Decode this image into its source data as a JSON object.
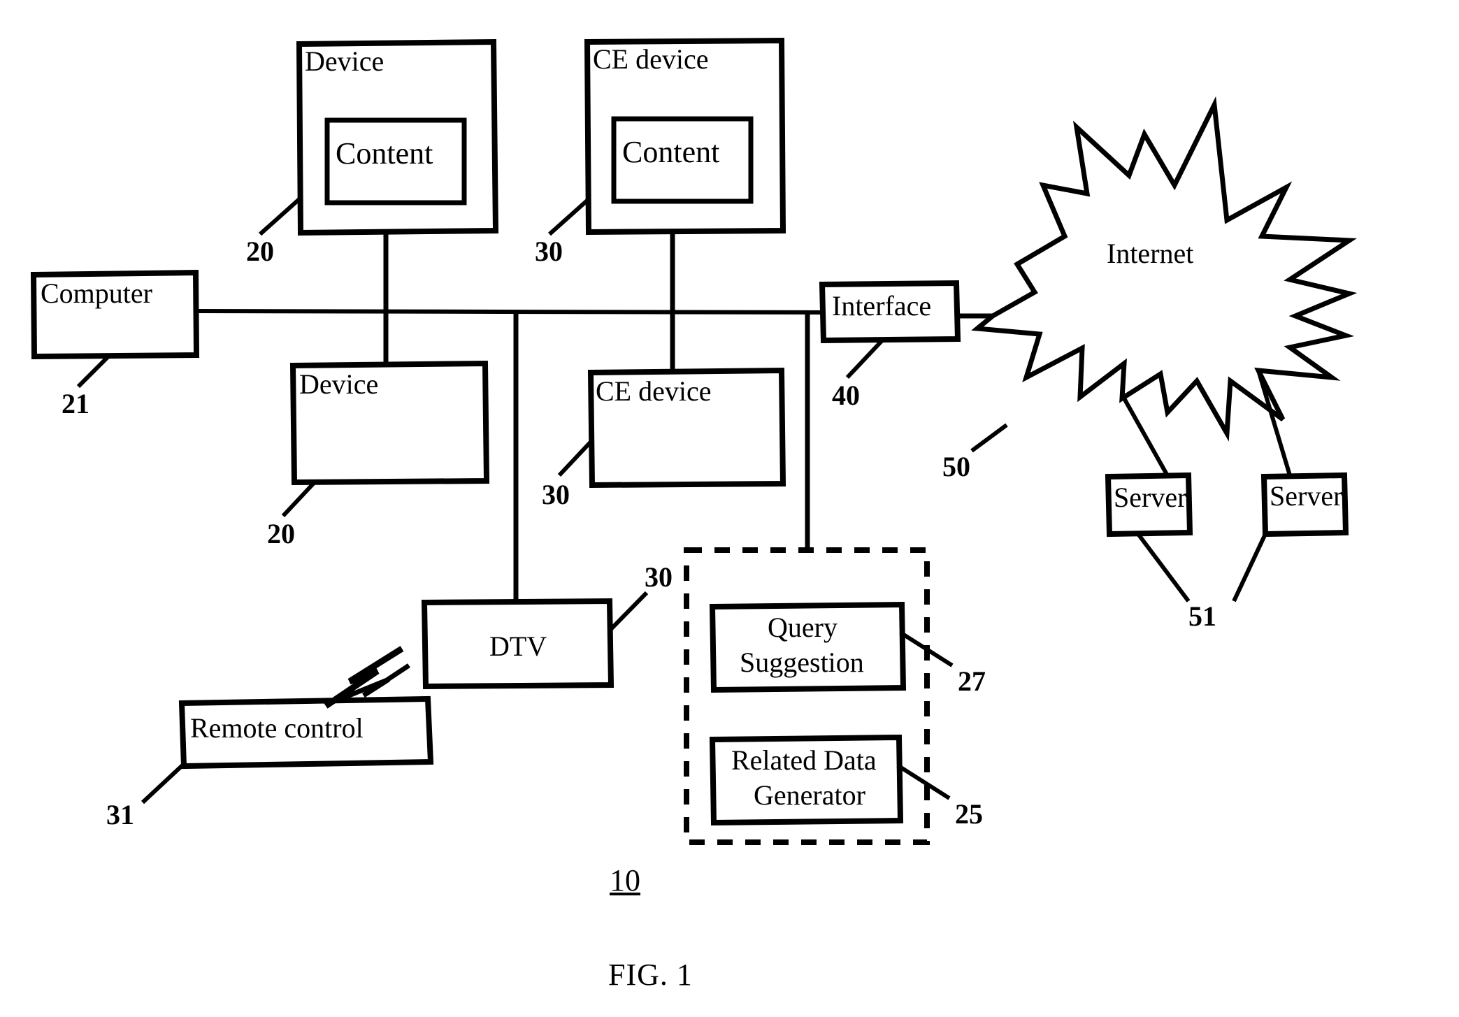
{
  "figure": {
    "caption": "FIG. 1",
    "system_number": "10"
  },
  "nodes": {
    "device_top": {
      "label": "Device",
      "ref": "20"
    },
    "device_top_content": {
      "label": "Content"
    },
    "ce_device_top": {
      "label": "CE device",
      "ref": "30"
    },
    "ce_device_top_content": {
      "label": "Content"
    },
    "computer": {
      "label": "Computer",
      "ref": "21"
    },
    "device_bottom": {
      "label": "Device",
      "ref": "20"
    },
    "ce_device_bottom": {
      "label": "CE device",
      "ref": "30"
    },
    "interface": {
      "label": "Interface",
      "ref": "40"
    },
    "internet": {
      "label": "Internet",
      "ref": "50"
    },
    "server_left": {
      "label": "Server"
    },
    "server_right": {
      "label": "Server"
    },
    "server_ref": "51",
    "dtv": {
      "label": "DTV",
      "ref": "30"
    },
    "remote_control": {
      "label": "Remote control",
      "ref": "31"
    },
    "query_suggestion": {
      "label_line1": "Query",
      "label_line2": "Suggestion",
      "ref": "27"
    },
    "related_data_generator": {
      "label_line1": "Related Data",
      "label_line2": "Generator",
      "ref": "25"
    }
  },
  "style": {
    "stroke": "#000000",
    "background": "#ffffff"
  }
}
